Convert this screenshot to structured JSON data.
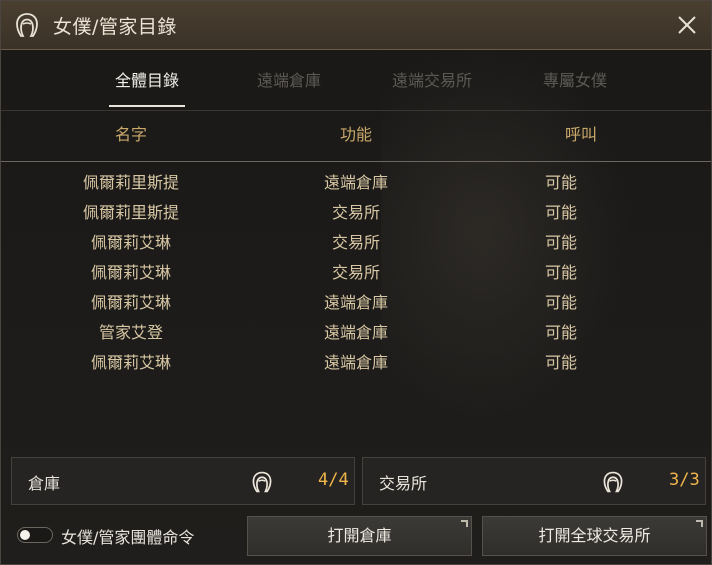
{
  "window": {
    "title": "女僕/管家目錄",
    "title_icon": "maid-head-icon",
    "close_icon": "close-icon"
  },
  "tabs": [
    {
      "label": "全體目錄",
      "active": true
    },
    {
      "label": "遠端倉庫",
      "active": false
    },
    {
      "label": "遠端交易所",
      "active": false
    },
    {
      "label": "專屬女僕",
      "active": false
    }
  ],
  "table": {
    "headers": [
      "名字",
      "功能",
      "呼叫"
    ],
    "rows": [
      {
        "name": "佩爾莉里斯提",
        "function": "遠端倉庫",
        "call": "可能"
      },
      {
        "name": "佩爾莉里斯提",
        "function": "交易所",
        "call": "可能"
      },
      {
        "name": "佩爾莉艾琳",
        "function": "交易所",
        "call": "可能"
      },
      {
        "name": "佩爾莉艾琳",
        "function": "交易所",
        "call": "可能"
      },
      {
        "name": "佩爾莉艾琳",
        "function": "遠端倉庫",
        "call": "可能"
      },
      {
        "name": "管家艾登",
        "function": "遠端倉庫",
        "call": "可能"
      },
      {
        "name": "佩爾莉艾琳",
        "function": "遠端倉庫",
        "call": "可能"
      }
    ]
  },
  "summary": {
    "warehouse": {
      "label": "倉庫",
      "count": "4/4",
      "icon": "maid-head-icon"
    },
    "market": {
      "label": "交易所",
      "count": "3/3",
      "icon": "maid-head-icon"
    }
  },
  "footer": {
    "toggle_label": "女僕/管家團體命令",
    "toggle_on": false,
    "open_warehouse": "打開倉庫",
    "open_market": "打開全球交易所"
  },
  "colors": {
    "accent_gold": "#c9a96a",
    "count_orange": "#f0b54a",
    "row_text": "#d8c7a4"
  }
}
